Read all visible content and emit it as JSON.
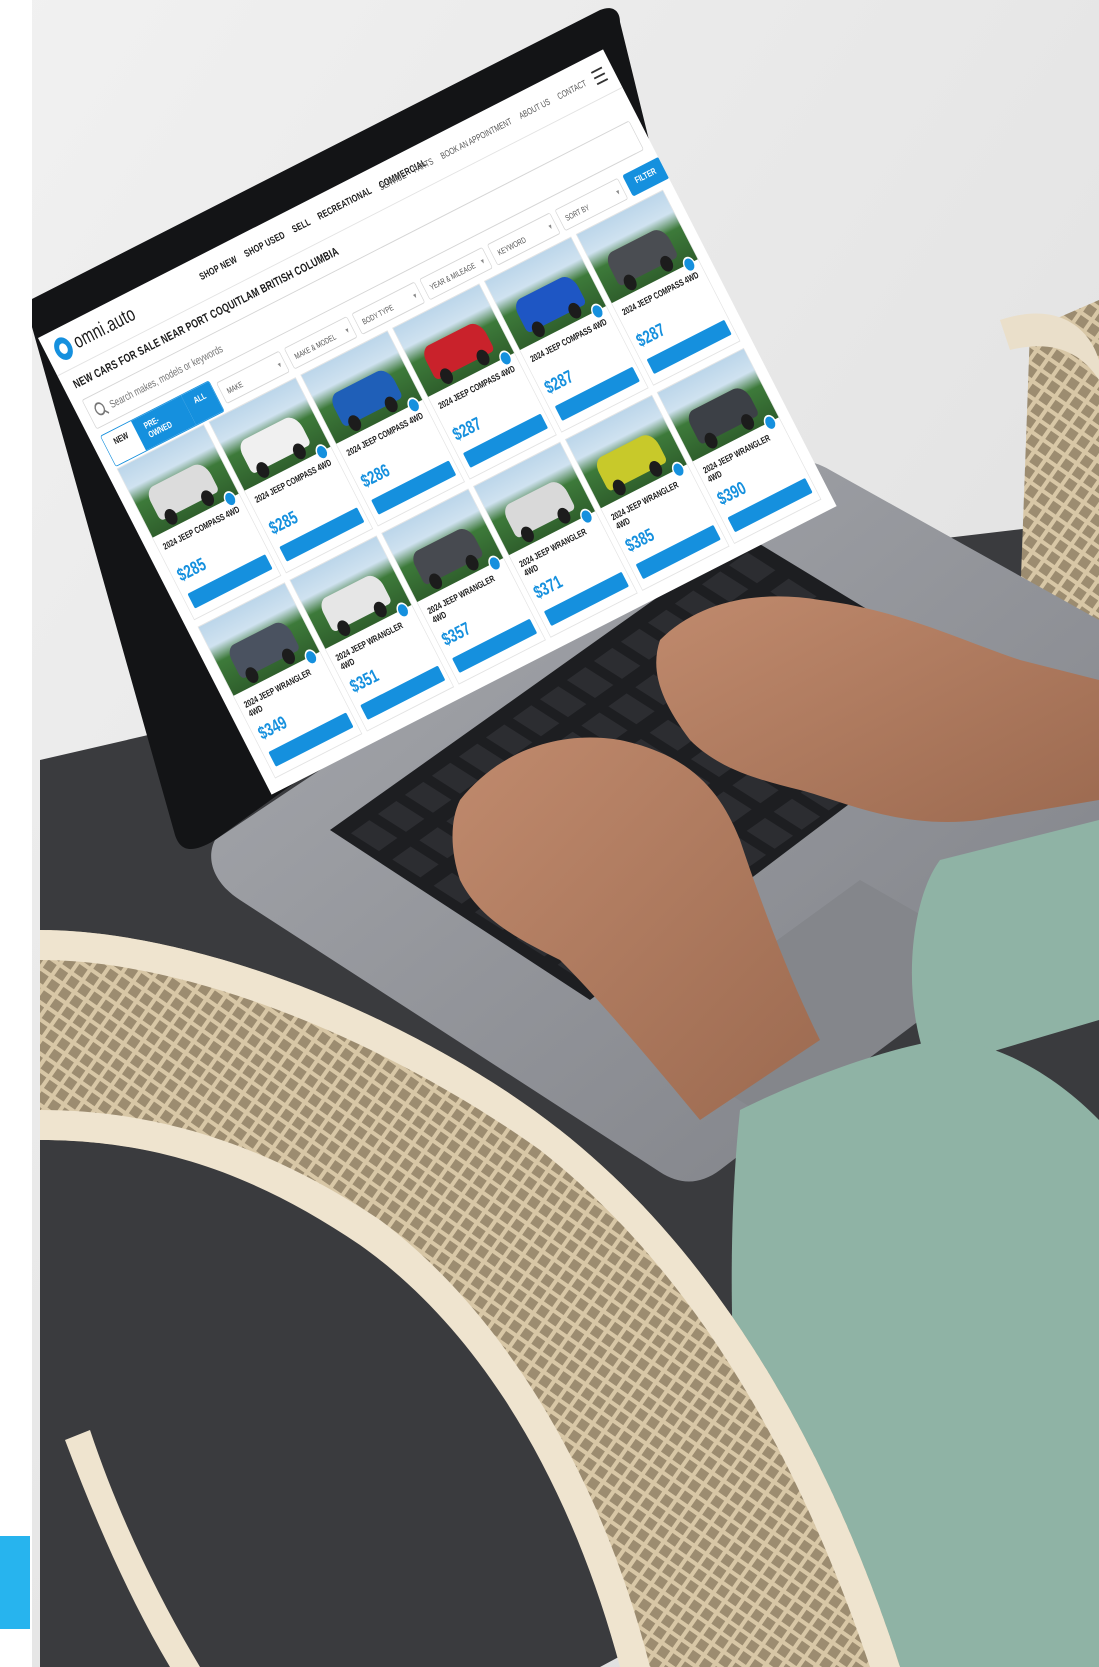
{
  "site": {
    "logo_text": "omni.auto",
    "nav": [
      "SHOP NEW",
      "SHOP USED",
      "SELL",
      "RECREATIONAL",
      "COMMERCIAL"
    ],
    "nav_right": [
      "SERVICE",
      "PARTS",
      "BOOK AN APPOINTMENT",
      "ABOUT US",
      "CONTACT"
    ],
    "heading": "NEW CARS FOR SALE NEAR PORT COQUITLAM BRITISH COLUMBIA",
    "search_placeholder": "Search makes, models or keywords"
  },
  "filters": {
    "condition_tabs": [
      {
        "label": "NEW",
        "active": false
      },
      {
        "label": "PRE-OWNED",
        "active": true
      },
      {
        "label": "ALL",
        "active": true
      }
    ],
    "dropdowns": [
      "MAKE",
      "MAKE & MODEL",
      "BODY TYPE",
      "YEAR & MILEAGE",
      "KEYWORD",
      "SORT BY"
    ],
    "filter_button": "FILTER"
  },
  "listings": [
    {
      "title": "2024 JEEP COMPASS 4WD",
      "price": "$285",
      "color": "#dcdcdc"
    },
    {
      "title": "2024 JEEP COMPASS 4WD",
      "price": "$285",
      "color": "#f0f0f0"
    },
    {
      "title": "2024 JEEP COMPASS 4WD",
      "price": "$286",
      "color": "#1f5fb8"
    },
    {
      "title": "2024 JEEP COMPASS 4WD",
      "price": "$287",
      "color": "#c9222b"
    },
    {
      "title": "2024 JEEP COMPASS 4WD",
      "price": "$287",
      "color": "#1e56c4"
    },
    {
      "title": "2024 JEEP COMPASS 4WD",
      "price": "$287",
      "color": "#4a4d52"
    },
    {
      "title": "2024 JEEP WRANGLER 4WD",
      "price": "$349",
      "color": "#4a5260"
    },
    {
      "title": "2024 JEEP WRANGLER 4WD",
      "price": "$351",
      "color": "#e6e6e6"
    },
    {
      "title": "2024 JEEP WRANGLER 4WD",
      "price": "$357",
      "color": "#474a50"
    },
    {
      "title": "2024 JEEP WRANGLER 4WD",
      "price": "$371",
      "color": "#d9d9d9"
    },
    {
      "title": "2024 JEEP WRANGLER 4WD",
      "price": "$385",
      "color": "#c8c92a"
    },
    {
      "title": "2024 JEEP WRANGLER 4WD",
      "price": "$390",
      "color": "#3c4046"
    }
  ],
  "colors": {
    "brand_blue": "#1590de",
    "accent_strip": "#27b4ee",
    "laptop_body": "#8e9095",
    "keyboard": "#1d1e21",
    "sweater": "#8fb3a5",
    "chair": "#e8dcc6"
  },
  "icons": [
    "search-icon",
    "menu-icon",
    "favorite-icon",
    "logo-icon"
  ]
}
